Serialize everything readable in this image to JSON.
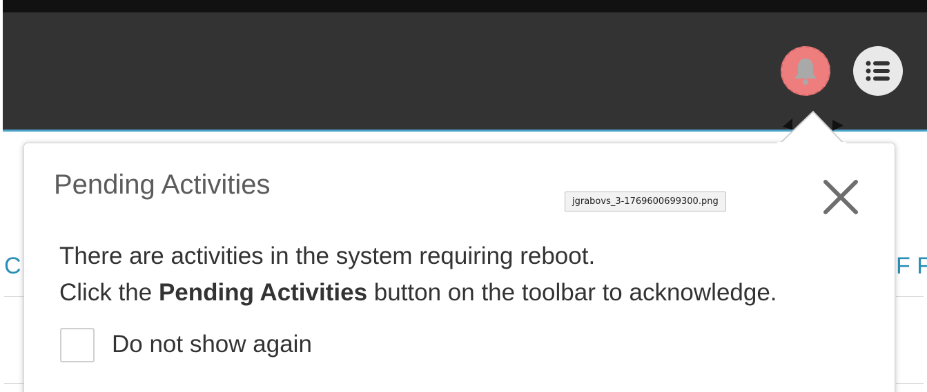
{
  "toolbar": {
    "bell_icon": "bell-icon",
    "menu_icon": "list-menu-icon",
    "bell_color": "#ee7d7d",
    "header_color": "#333333",
    "accent_color": "#4aa3c8"
  },
  "background": {
    "left_fragment": "C",
    "right_fragment": "F F"
  },
  "popover": {
    "title": "Pending Activities",
    "tooltip": "jgrabovs_3-1769600699300.png",
    "message_line1": "There are activities in the system requiring reboot.",
    "message_line2_prefix": "Click the ",
    "message_line2_bold": "Pending Activities",
    "message_line2_suffix": " button on the toolbar to acknowledge.",
    "checkbox_label": "Do not show again",
    "checkbox_checked": false
  }
}
